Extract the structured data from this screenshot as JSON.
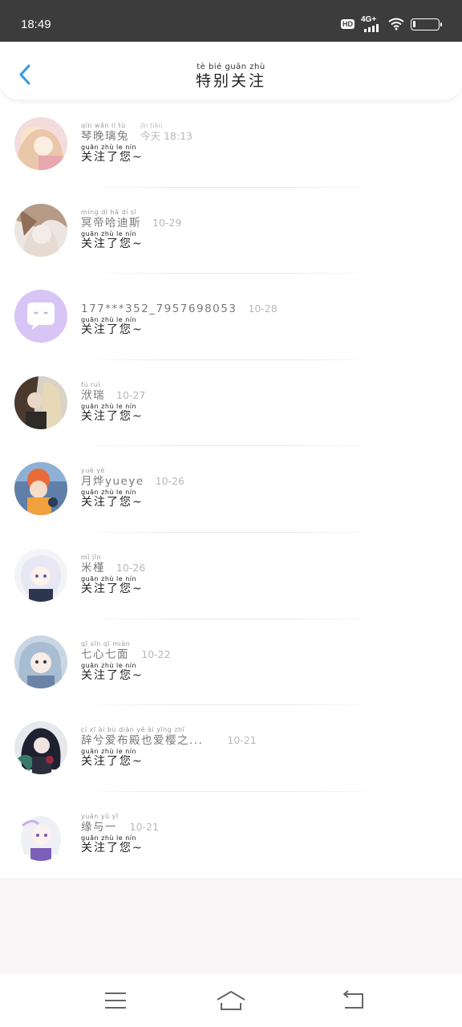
{
  "status": {
    "time": "18:49",
    "hd": "HD",
    "network": "4G+"
  },
  "header": {
    "title_pinyin": "tè  bié  guān zhù",
    "title": "特别关注"
  },
  "items": [
    {
      "name_pinyin": "qín wǎn  lí   tù",
      "name": "琴晚璃兔",
      "time_pinyin": "jīn tiān",
      "time": "今天 18:13",
      "msg_pinyin": "guān zhù   le   nín",
      "msg": "关注了您~"
    },
    {
      "name_pinyin": "míng dì  hā  dí  sī",
      "name": "冥帝哈迪斯",
      "time_pinyin": "",
      "time": "10-29",
      "msg_pinyin": "guān zhù   le   nín",
      "msg": "关注了您~"
    },
    {
      "name_pinyin": "",
      "name": "177***352_7957698053",
      "time_pinyin": "",
      "time": "10-28",
      "msg_pinyin": "guān zhù   le   nín",
      "msg": "关注了您~"
    },
    {
      "name_pinyin": "fú  ruì",
      "name": "洑瑞",
      "time_pinyin": "",
      "time": "10-27",
      "msg_pinyin": "guān zhù   le   nín",
      "msg": "关注了您~"
    },
    {
      "name_pinyin": "yuè  yè",
      "name": "月烨yueye",
      "time_pinyin": "",
      "time": "10-26",
      "msg_pinyin": "guān zhù   le   nín",
      "msg": "关注了您~"
    },
    {
      "name_pinyin": "mǐ  jǐn",
      "name": "米槿",
      "time_pinyin": "",
      "time": "10-26",
      "msg_pinyin": "guān zhù   le   nín",
      "msg": "关注了您~"
    },
    {
      "name_pinyin": "qī  xīn  qī  miàn",
      "name": "七心七面",
      "time_pinyin": "",
      "time": "10-22",
      "msg_pinyin": "guān zhù   le   nín",
      "msg": "关注了您~"
    },
    {
      "name_pinyin": "cí  xī  ài  bù diàn yě  ài yīng zhī",
      "name": "辞兮爱布殿也爱樱之...",
      "time_pinyin": "",
      "time": "10-21",
      "msg_pinyin": "guān zhù   le   nín",
      "msg": "关注了您~"
    },
    {
      "name_pinyin": "yuán yǔ  yī",
      "name": "缘与一",
      "time_pinyin": "",
      "time": "10-21",
      "msg_pinyin": "guān zhù   le   nín",
      "msg": "关注了您~"
    }
  ],
  "colors": {
    "accent": "#2a9de6",
    "status_bg": "#3c3c3c",
    "default_avatar": "#d8c4f5"
  },
  "icons": {
    "back": "chevron-left-icon",
    "menu": "menu-icon",
    "home": "home-icon",
    "return": "back-arrow-icon"
  }
}
